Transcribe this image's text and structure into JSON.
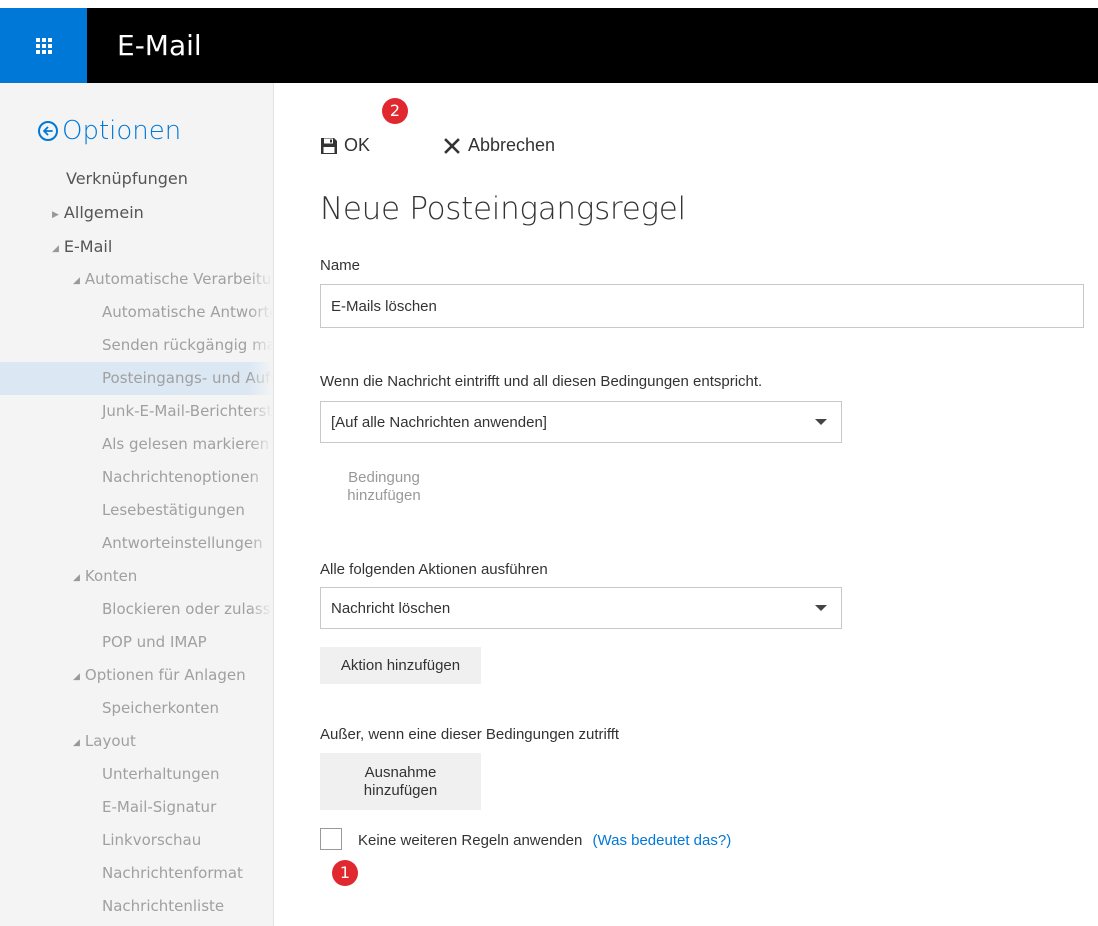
{
  "header": {
    "app_title": "E-Mail",
    "app_launcher_icon": "waffle-grid-icon",
    "accent_color": "#0078d7"
  },
  "sidebar": {
    "back_label": "Optionen",
    "back_icon": "back-arrow-circle-icon",
    "items": [
      {
        "label": "Verknüpfungen",
        "level": 0
      },
      {
        "label": "Allgemein",
        "level": 0,
        "expand": "collapsed"
      },
      {
        "label": "E-Mail",
        "level": 0,
        "expand": "expanded"
      },
      {
        "label": "Automatische Verarbeitung",
        "level": 1,
        "expand": "expanded"
      },
      {
        "label": "Automatische Antworten",
        "level": 2
      },
      {
        "label": "Senden rückgängig machen",
        "level": 2
      },
      {
        "label": "Posteingangs- und Aufräumregeln",
        "level": 2,
        "selected": true
      },
      {
        "label": "Junk-E-Mail-Berichterstattung",
        "level": 2
      },
      {
        "label": "Als gelesen markieren",
        "level": 2
      },
      {
        "label": "Nachrichtenoptionen",
        "level": 2
      },
      {
        "label": "Lesebestätigungen",
        "level": 2
      },
      {
        "label": "Antworteinstellungen",
        "level": 2
      },
      {
        "label": "Konten",
        "level": 1,
        "expand": "expanded"
      },
      {
        "label": "Blockieren oder zulassen",
        "level": 2
      },
      {
        "label": "POP und IMAP",
        "level": 2
      },
      {
        "label": "Optionen für Anlagen",
        "level": 1,
        "expand": "expanded"
      },
      {
        "label": "Speicherkonten",
        "level": 2
      },
      {
        "label": "Layout",
        "level": 1,
        "expand": "expanded"
      },
      {
        "label": "Unterhaltungen",
        "level": 2
      },
      {
        "label": "E-Mail-Signatur",
        "level": 2
      },
      {
        "label": "Linkvorschau",
        "level": 2
      },
      {
        "label": "Nachrichtenformat",
        "level": 2
      },
      {
        "label": "Nachrichtenliste",
        "level": 2
      }
    ]
  },
  "toolbar": {
    "ok_label": "OK",
    "ok_icon": "save-disk-icon",
    "cancel_label": "Abbrechen",
    "cancel_icon": "close-x-icon"
  },
  "annotations": {
    "badge_ok": "2",
    "badge_checkbox": "1",
    "badge_color": "#e0282e"
  },
  "form": {
    "title": "Neue Posteingangsregel",
    "name_label": "Name",
    "name_value": "E-Mails löschen",
    "condition_label": "Wenn die Nachricht eintrifft und all diesen Bedingungen entspricht.",
    "condition_value": "[Auf alle Nachrichten anwenden]",
    "add_condition_label": "Bedingung hinzufügen",
    "actions_label": "Alle folgenden Aktionen ausführen",
    "action_value": "Nachricht löschen",
    "add_action_label": "Aktion hinzufügen",
    "exceptions_label": "Außer, wenn eine dieser Bedingungen zutrifft",
    "add_exception_label": "Ausnahme hinzufügen",
    "stop_rules_label": "Keine weiteren Regeln anwenden",
    "stop_rules_checked": false,
    "help_link": "(Was bedeutet das?)"
  }
}
